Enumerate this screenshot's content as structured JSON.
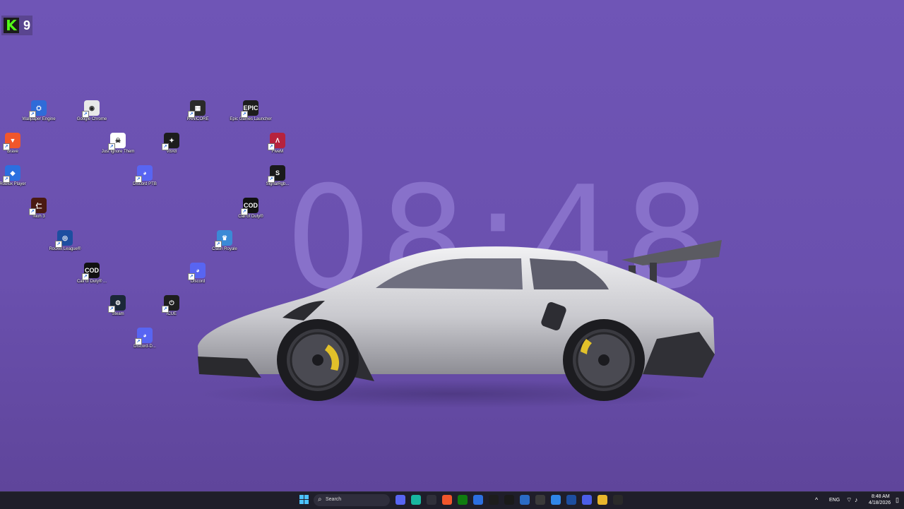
{
  "desktop": {
    "clock": "08:48",
    "widget": {
      "badge": "K",
      "count": "9"
    },
    "icons": [
      {
        "label": "Wallpaper Engine",
        "color": "#2f6bd8",
        "glyph": "⛭"
      },
      {
        "label": "Google Chrome",
        "color": "#e8e8e8",
        "glyph": "◉"
      },
      {
        "label": "PANICORE",
        "color": "#2a2a2a",
        "glyph": "▦"
      },
      {
        "label": "Epic Games Launcher",
        "color": "#1d1d1d",
        "glyph": "EPIC"
      },
      {
        "label": "Brave",
        "color": "#f1562b",
        "glyph": "▼"
      },
      {
        "label": "Just Ignore Them",
        "color": "#ffffff",
        "glyph": "☠"
      },
      {
        "label": "V8X8",
        "color": "#1c1c1c",
        "glyph": "✦"
      },
      {
        "label": "FiveM",
        "color": "#b7223d",
        "glyph": "Λ"
      },
      {
        "label": "Roblox Player",
        "color": "#2c6fe0",
        "glyph": "◆"
      },
      {
        "label": "Discord PTB",
        "color": "#5865f2",
        "glyph": "◕"
      },
      {
        "label": "SignalRgb...",
        "color": "#1a1a1a",
        "glyph": "S"
      },
      {
        "label": "Nioh 3",
        "color": "#4a1a12",
        "glyph": "仁"
      },
      {
        "label": "Call of Duty®",
        "color": "#111111",
        "glyph": "COD"
      },
      {
        "label": "Rocket League®",
        "color": "#1d4ea0",
        "glyph": "◎"
      },
      {
        "label": "Clash Royale",
        "color": "#3b8ad6",
        "glyph": "♛"
      },
      {
        "label": "Call of Duty® ...",
        "color": "#111111",
        "glyph": "COD"
      },
      {
        "label": "Discord",
        "color": "#5865f2",
        "glyph": "◕"
      },
      {
        "label": "Steam",
        "color": "#1b2838",
        "glyph": "⚙"
      },
      {
        "label": "iCUE",
        "color": "#1e1e1e",
        "glyph": "⏻"
      },
      {
        "label": "Discord-D...",
        "color": "#5865f2",
        "glyph": "◕"
      }
    ]
  },
  "taskbar": {
    "search_label": "Search",
    "search_icon": "search-icon",
    "apps": [
      {
        "name": "discord-taskbar-icon",
        "color": "#5865f2"
      },
      {
        "name": "hub-taskbar-icon",
        "color": "#18b7a0"
      },
      {
        "name": "obs-taskbar-icon",
        "color": "#30303a"
      },
      {
        "name": "brave-taskbar-icon",
        "color": "#f1562b"
      },
      {
        "name": "xbox-taskbar-icon",
        "color": "#107c10"
      },
      {
        "name": "roblox-taskbar-icon",
        "color": "#2c6fe0"
      },
      {
        "name": "epic-taskbar-icon",
        "color": "#1d1d1d"
      },
      {
        "name": "cod-taskbar-icon",
        "color": "#1a1a1a"
      },
      {
        "name": "shield-taskbar-icon",
        "color": "#2a6bc4"
      },
      {
        "name": "app-taskbar-icon",
        "color": "#3a3a3a"
      },
      {
        "name": "drop-taskbar-icon",
        "color": "#2f86e8"
      },
      {
        "name": "rocket-taskbar-icon",
        "color": "#1d4ea0"
      },
      {
        "name": "play-taskbar-icon",
        "color": "#4b5ee8"
      },
      {
        "name": "folder-taskbar-icon",
        "color": "#e8b62c"
      },
      {
        "name": "panicore-taskbar-icon",
        "color": "#2a2a2a"
      }
    ],
    "tray": {
      "chevron": "^",
      "language": "ENG",
      "time": "8:48 AM",
      "date": "4/18/2026"
    }
  }
}
